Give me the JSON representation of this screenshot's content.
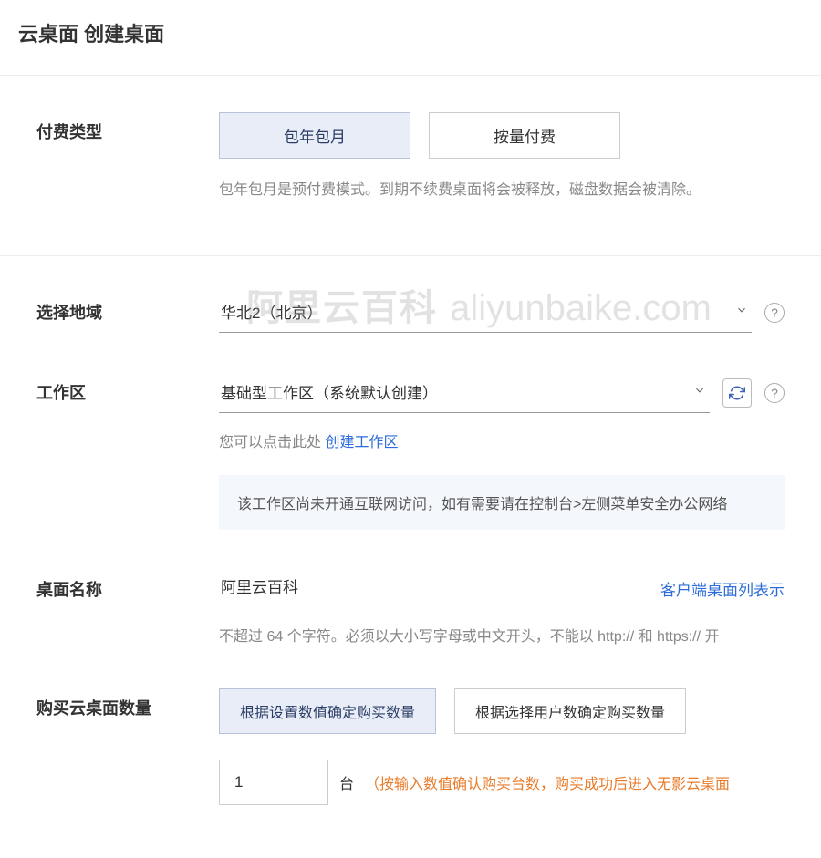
{
  "header": {
    "title": "云桌面 创建桌面"
  },
  "watermark": {
    "cn": "阿里云百科",
    "latin": "aliyunbaike.com"
  },
  "billing": {
    "label": "付费类型",
    "options": {
      "subscription": "包年包月",
      "payg": "按量付费"
    },
    "hint": "包年包月是预付费模式。到期不续费桌面将会被释放，磁盘数据会被清除。"
  },
  "region": {
    "label": "选择地域",
    "value": "华北2（北京）"
  },
  "workspace": {
    "label": "工作区",
    "value": "基础型工作区（系统默认创建）",
    "prefix_text": "您可以点击此处",
    "create_link": "创建工作区",
    "notice": "该工作区尚未开通互联网访问，如有需要请在控制台>左侧菜单安全办公网络"
  },
  "desktop_name": {
    "label": "桌面名称",
    "value": "阿里云百科",
    "client_link": "客户端桌面列表示",
    "hint": "不超过 64 个字符。必须以大小写字母或中文开头，不能以 http:// 和 https:// 开"
  },
  "quantity": {
    "label": "购买云桌面数量",
    "options": {
      "by_value": "根据设置数值确定购买数量",
      "by_users": "根据选择用户数确定购买数量"
    },
    "value": "1",
    "unit": "台",
    "note": "（按输入数值确认购买台数，购买成功后进入无影云桌面"
  }
}
